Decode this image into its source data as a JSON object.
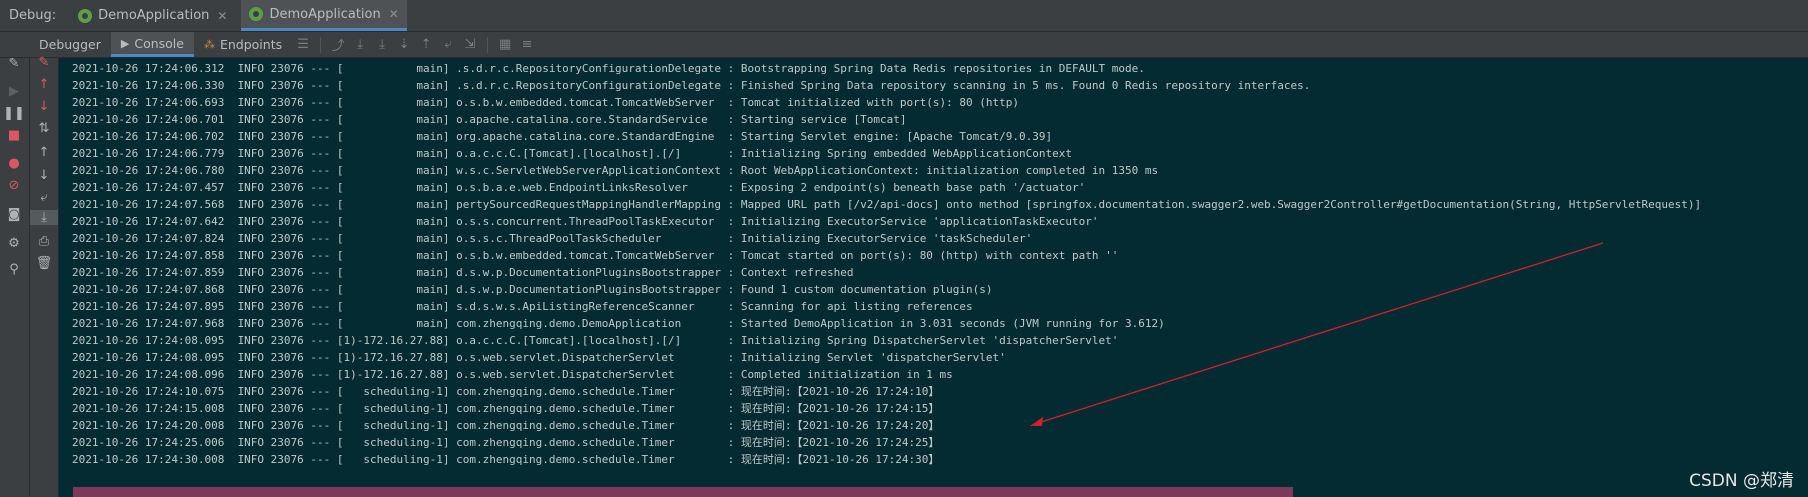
{
  "topbar": {
    "debug_label": "Debug:",
    "tabs": [
      {
        "label": "DemoApplication",
        "close": "✕"
      },
      {
        "label": "DemoApplication",
        "close": "✕"
      }
    ]
  },
  "toolbar": {
    "tabs": [
      {
        "label": "Debugger"
      },
      {
        "label": "Console"
      },
      {
        "label": "Endpoints"
      }
    ]
  },
  "console": {
    "lines": [
      "2021-10-26 17:24:06.312  INFO 23076 --- [           main] .s.d.r.c.RepositoryConfigurationDelegate : Bootstrapping Spring Data Redis repositories in DEFAULT mode.",
      "2021-10-26 17:24:06.330  INFO 23076 --- [           main] .s.d.r.c.RepositoryConfigurationDelegate : Finished Spring Data repository scanning in 5 ms. Found 0 Redis repository interfaces.",
      "2021-10-26 17:24:06.693  INFO 23076 --- [           main] o.s.b.w.embedded.tomcat.TomcatWebServer  : Tomcat initialized with port(s): 80 (http)",
      "2021-10-26 17:24:06.701  INFO 23076 --- [           main] o.apache.catalina.core.StandardService   : Starting service [Tomcat]",
      "2021-10-26 17:24:06.702  INFO 23076 --- [           main] org.apache.catalina.core.StandardEngine  : Starting Servlet engine: [Apache Tomcat/9.0.39]",
      "2021-10-26 17:24:06.779  INFO 23076 --- [           main] o.a.c.c.C.[Tomcat].[localhost].[/]       : Initializing Spring embedded WebApplicationContext",
      "2021-10-26 17:24:06.780  INFO 23076 --- [           main] w.s.c.ServletWebServerApplicationContext : Root WebApplicationContext: initialization completed in 1350 ms",
      "2021-10-26 17:24:07.457  INFO 23076 --- [           main] o.s.b.a.e.web.EndpointLinksResolver      : Exposing 2 endpoint(s) beneath base path '/actuator'",
      "2021-10-26 17:24:07.568  INFO 23076 --- [           main] pertySourcedRequestMappingHandlerMapping : Mapped URL path [/v2/api-docs] onto method [springfox.documentation.swagger2.web.Swagger2Controller#getDocumentation(String, HttpServletRequest)]",
      "2021-10-26 17:24:07.642  INFO 23076 --- [           main] o.s.s.concurrent.ThreadPoolTaskExecutor  : Initializing ExecutorService 'applicationTaskExecutor'",
      "2021-10-26 17:24:07.824  INFO 23076 --- [           main] o.s.s.c.ThreadPoolTaskScheduler          : Initializing ExecutorService 'taskScheduler'",
      "2021-10-26 17:24:07.858  INFO 23076 --- [           main] o.s.b.w.embedded.tomcat.TomcatWebServer  : Tomcat started on port(s): 80 (http) with context path ''",
      "2021-10-26 17:24:07.859  INFO 23076 --- [           main] d.s.w.p.DocumentationPluginsBootstrapper : Context refreshed",
      "2021-10-26 17:24:07.868  INFO 23076 --- [           main] d.s.w.p.DocumentationPluginsBootstrapper : Found 1 custom documentation plugin(s)",
      "2021-10-26 17:24:07.895  INFO 23076 --- [           main] s.d.s.w.s.ApiListingReferenceScanner     : Scanning for api listing references",
      "2021-10-26 17:24:07.968  INFO 23076 --- [           main] com.zhengqing.demo.DemoApplication       : Started DemoApplication in 3.031 seconds (JVM running for 3.612)",
      "2021-10-26 17:24:08.095  INFO 23076 --- [1)-172.16.27.88] o.a.c.c.C.[Tomcat].[localhost].[/]       : Initializing Spring DispatcherServlet 'dispatcherServlet'",
      "2021-10-26 17:24:08.095  INFO 23076 --- [1)-172.16.27.88] o.s.web.servlet.DispatcherServlet        : Initializing Servlet 'dispatcherServlet'",
      "2021-10-26 17:24:08.096  INFO 23076 --- [1)-172.16.27.88] o.s.web.servlet.DispatcherServlet        : Completed initialization in 1 ms",
      "2021-10-26 17:24:10.075  INFO 23076 --- [   scheduling-1] com.zhengqing.demo.schedule.Timer        : 现在时间:【2021-10-26 17:24:10】",
      "2021-10-26 17:24:15.008  INFO 23076 --- [   scheduling-1] com.zhengqing.demo.schedule.Timer        : 现在时间:【2021-10-26 17:24:15】",
      "2021-10-26 17:24:20.008  INFO 23076 --- [   scheduling-1] com.zhengqing.demo.schedule.Timer        : 现在时间:【2021-10-26 17:24:20】",
      "2021-10-26 17:24:25.006  INFO 23076 --- [   scheduling-1] com.zhengqing.demo.schedule.Timer        : 现在时间:【2021-10-26 17:24:25】",
      "2021-10-26 17:24:30.008  INFO 23076 --- [   scheduling-1] com.zhengqing.demo.schedule.Timer        : 现在时间:【2021-10-26 17:24:30】"
    ]
  },
  "watermark": "CSDN @郑清",
  "colors": {
    "console_bg": "#052b32",
    "panel_bg": "#3c3f41",
    "annotation_arrow": "#d0202a"
  }
}
